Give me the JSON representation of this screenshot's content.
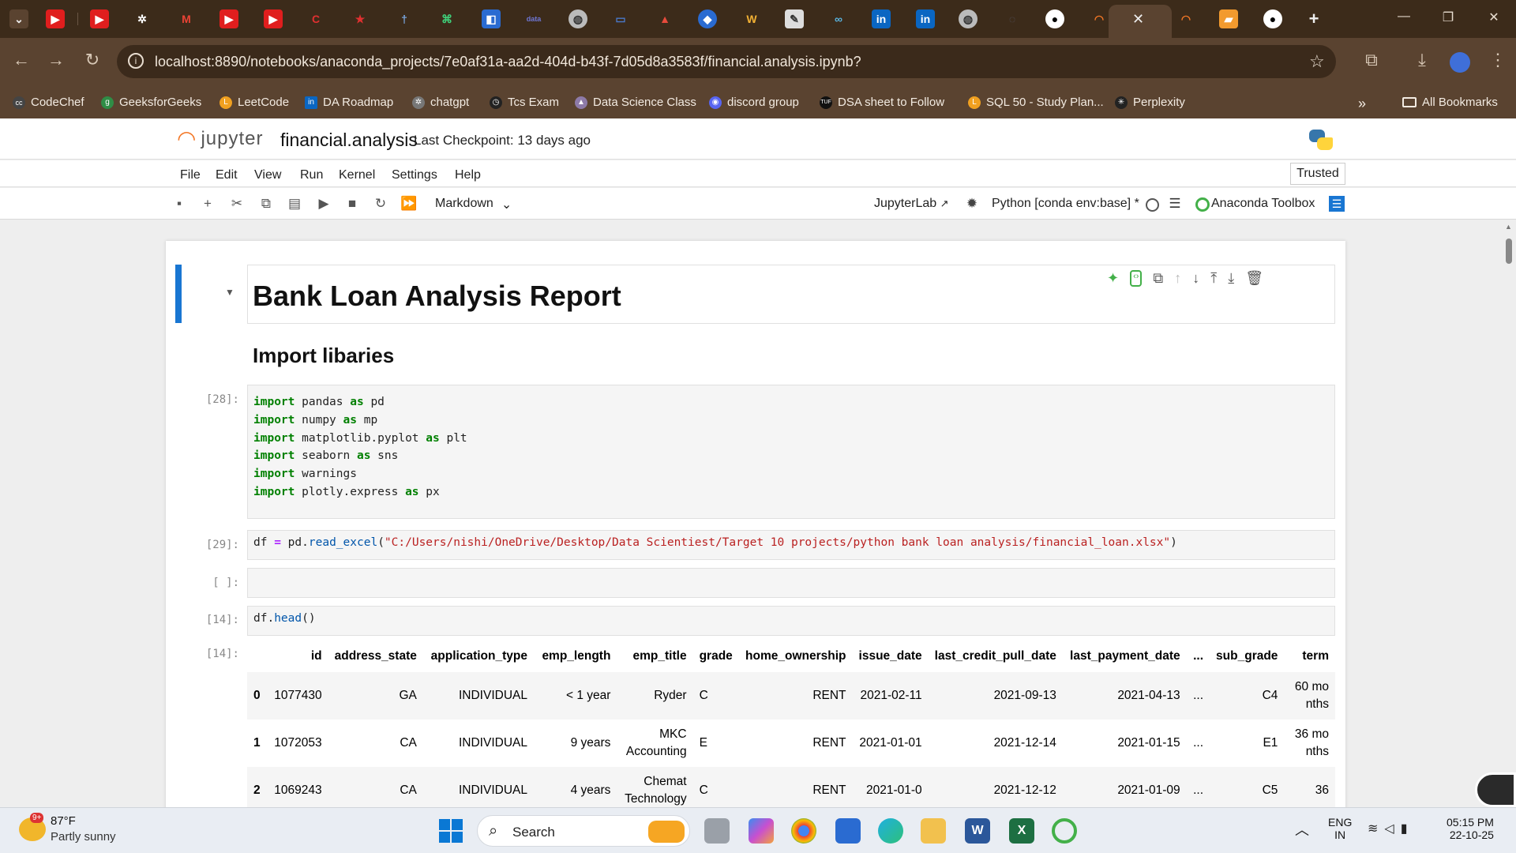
{
  "browser": {
    "url": "localhost:8890/notebooks/anaconda_projects/7e0af31a-aa2d-404d-b43f-7d05d8a3583f/financial.analysis.ipynb?",
    "bookmarks": [
      "CodeChef",
      "GeeksforGeeks",
      "LeetCode",
      "DA Roadmap",
      "chatgpt",
      "Tcs Exam",
      "Data Science Class",
      "discord group",
      "DSA sheet to Follow",
      "SQL 50 - Study Plan...",
      "Perplexity"
    ],
    "all_bookmarks": "All Bookmarks",
    "more": "»"
  },
  "jupyter": {
    "logo": "jupyter",
    "notebook_name": "financial.analysis",
    "checkpoint": "Last Checkpoint: 13 days ago",
    "trusted": "Trusted",
    "menus": [
      "File",
      "Edit",
      "View",
      "Run",
      "Kernel",
      "Settings",
      "Help"
    ],
    "cell_type": "Markdown",
    "jupyterlab": "JupyterLab",
    "kernel": "Python [conda env:base] *",
    "anaconda": "Anaconda Toolbox"
  },
  "notebook": {
    "title": "Bank Loan Analysis Report",
    "subtitle": "Import libaries",
    "cell28": {
      "prompt": "[28]:",
      "lines": [
        [
          "import",
          "pandas",
          "as",
          "pd"
        ],
        [
          "import",
          "numpy",
          "as",
          "mp"
        ],
        [
          "import",
          "matplotlib.pyplot",
          "as",
          "plt"
        ],
        [
          "import",
          "seaborn",
          "as",
          "sns"
        ],
        [
          "import",
          "warnings",
          "",
          ""
        ],
        [
          "import",
          "plotly.express",
          "as",
          "px"
        ]
      ]
    },
    "cell29": {
      "prompt": "[29]:",
      "var": "df",
      "eq": "=",
      "obj": "pd",
      "fn": "read_excel",
      "path": "\"C:/Users/nishi/OneDrive/Desktop/Data Scientiest/Target 10 projects/python bank loan analysis/financial_loan.xlsx\""
    },
    "cell_empty": {
      "prompt": "[ ]:"
    },
    "cell14": {
      "prompt": "[14]:",
      "obj": "df",
      "fn": "head",
      "out_prompt": "[14]:"
    },
    "table": {
      "columns": [
        "",
        "id",
        "address_state",
        "application_type",
        "emp_length",
        "emp_title",
        "grade",
        "home_ownership",
        "issue_date",
        "last_credit_pull_date",
        "last_payment_date",
        "...",
        "sub_grade",
        "term"
      ],
      "rows": [
        [
          "0",
          "1077430",
          "GA",
          "INDIVIDUAL",
          "< 1 year",
          "Ryder",
          "C",
          "RENT",
          "2021-02-11",
          "2021-09-13",
          "2021-04-13",
          "...",
          "C4",
          "60 months"
        ],
        [
          "1",
          "1072053",
          "CA",
          "INDIVIDUAL",
          "9 years",
          "MKC Accounting",
          "E",
          "RENT",
          "2021-01-01",
          "2021-12-14",
          "2021-01-15",
          "...",
          "E1",
          "36 months"
        ],
        [
          "2",
          "1069243",
          "CA",
          "INDIVIDUAL",
          "4 years",
          "Chemat Technology",
          "C",
          "RENT",
          "2021-01-0",
          "2021-12-12",
          "2021-01-09",
          "...",
          "C5",
          "36"
        ]
      ]
    }
  },
  "taskbar": {
    "weather_temp": "87°F",
    "weather_desc": "Partly sunny",
    "weather_badge": "9+",
    "search": "Search",
    "lang1": "ENG",
    "lang2": "IN",
    "time": "05:15 PM",
    "date": "22-10-25"
  },
  "colors": {
    "jupyter_orange": "#f37726",
    "cell_blue": "#1976d2",
    "accent": "#5a4330"
  }
}
